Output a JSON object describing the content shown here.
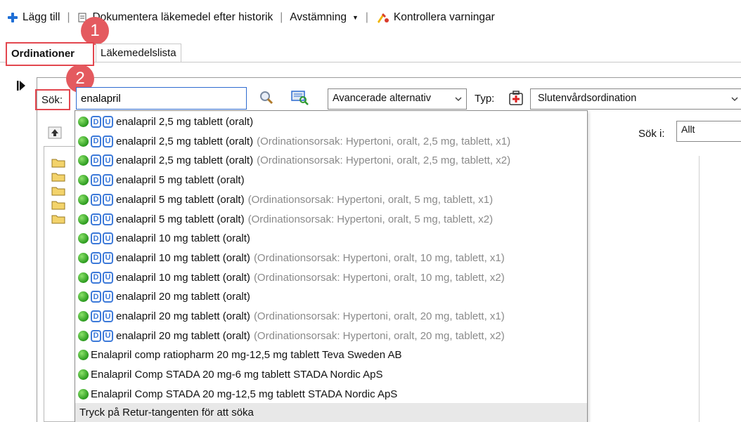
{
  "toolbar": {
    "add_label": "Lägg till",
    "document_label": "Dokumentera läkemedel efter historik",
    "reconcile_label": "Avstämning",
    "check_label": "Kontrollera varningar"
  },
  "tabs": [
    {
      "label": "Ordinationer"
    },
    {
      "label": "Läkemedelslista"
    }
  ],
  "badges": [
    "1",
    "2"
  ],
  "search": {
    "label": "Sök:",
    "value": "enalapril",
    "advanced_label": "Avancerade alternativ",
    "type_label": "Typ:",
    "type_value": "Slutenvårdsordination",
    "search_in_label": "Sök i:",
    "search_in_value": "Allt"
  },
  "dropdown": {
    "items": [
      {
        "name": "enalapril 2,5 mg tablett (oralt)",
        "reason": "",
        "icons": true
      },
      {
        "name": "enalapril 2,5 mg tablett (oralt)",
        "reason": "(Ordinationsorsak: Hypertoni, oralt, 2,5 mg, tablett, x1)",
        "icons": true
      },
      {
        "name": "enalapril 2,5 mg tablett (oralt)",
        "reason": "(Ordinationsorsak: Hypertoni, oralt, 2,5 mg, tablett, x2)",
        "icons": true
      },
      {
        "name": "enalapril 5 mg tablett (oralt)",
        "reason": "",
        "icons": true
      },
      {
        "name": "enalapril 5 mg tablett (oralt)",
        "reason": "(Ordinationsorsak: Hypertoni, oralt, 5 mg, tablett, x1)",
        "icons": true
      },
      {
        "name": "enalapril 5 mg tablett (oralt)",
        "reason": "(Ordinationsorsak: Hypertoni, oralt, 5 mg, tablett, x2)",
        "icons": true
      },
      {
        "name": "enalapril 10 mg tablett (oralt)",
        "reason": "",
        "icons": true
      },
      {
        "name": "enalapril 10 mg tablett (oralt)",
        "reason": "(Ordinationsorsak: Hypertoni, oralt, 10 mg, tablett, x1)",
        "icons": true
      },
      {
        "name": "enalapril 10 mg tablett (oralt)",
        "reason": "(Ordinationsorsak: Hypertoni, oralt, 10 mg, tablett, x2)",
        "icons": true
      },
      {
        "name": "enalapril 20 mg tablett (oralt)",
        "reason": "",
        "icons": true
      },
      {
        "name": "enalapril 20 mg tablett (oralt)",
        "reason": "(Ordinationsorsak: Hypertoni, oralt, 20 mg, tablett, x1)",
        "icons": true
      },
      {
        "name": "enalapril 20 mg tablett (oralt)",
        "reason": "(Ordinationsorsak: Hypertoni, oralt, 20 mg, tablett, x2)",
        "icons": true
      },
      {
        "name": "Enalapril comp ratiopharm 20 mg-12,5 mg tablett Teva Sweden AB",
        "reason": "",
        "icons": false
      },
      {
        "name": "Enalapril Comp STADA 20 mg-6 mg tablett STADA Nordic ApS",
        "reason": "",
        "icons": false
      },
      {
        "name": "Enalapril Comp STADA 20 mg-12,5 mg tablett STADA Nordic ApS",
        "reason": "",
        "icons": false
      }
    ],
    "footer": "Tryck på Retur-tangenten för att söka"
  },
  "colors": {
    "highlight_box": "#e3474f",
    "badge": "#e45a5f",
    "accent_blue": "#2f6bd0",
    "status_green": "#2b9a1e"
  }
}
